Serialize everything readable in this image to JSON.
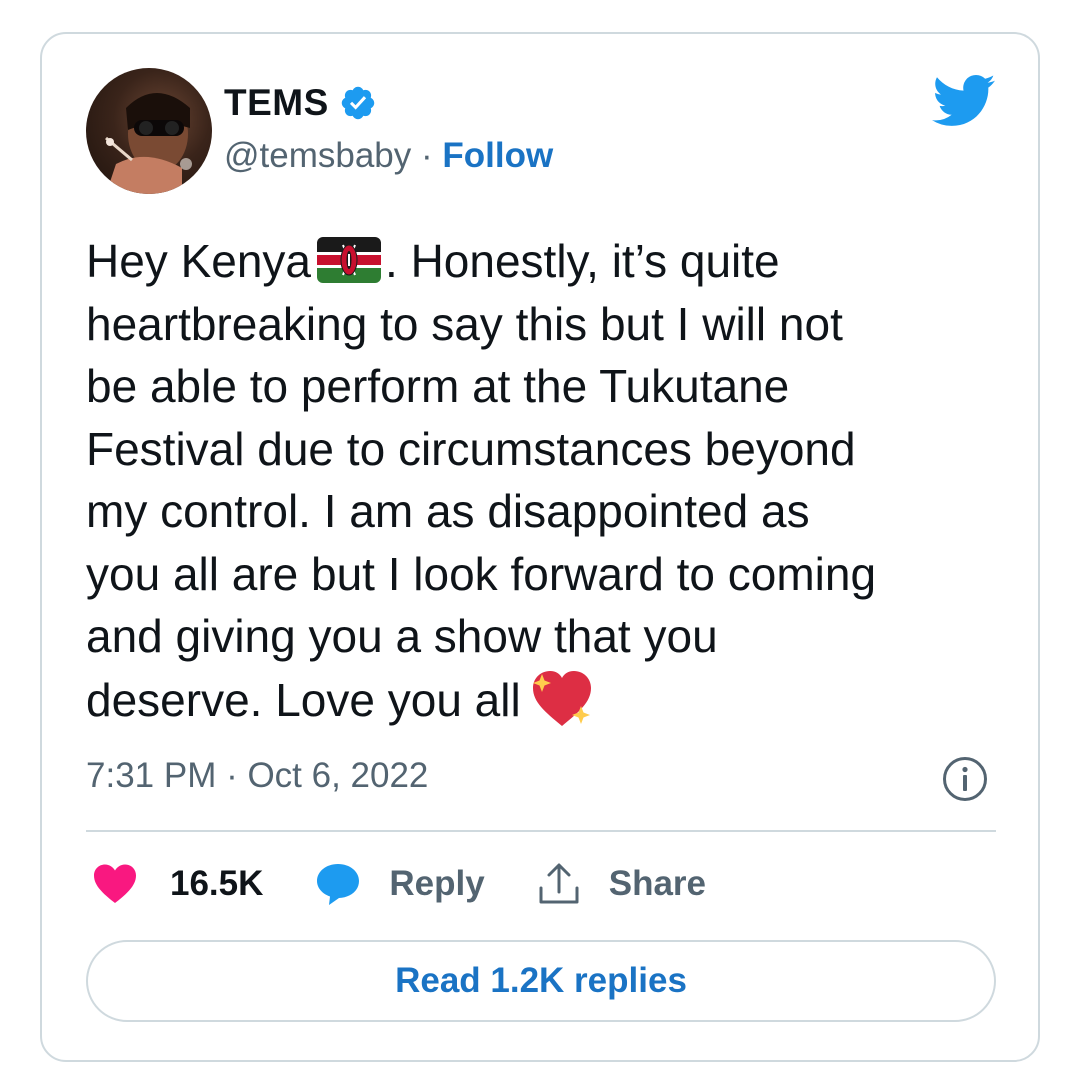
{
  "author": {
    "name": "TEMS",
    "handle": "@temsbaby",
    "separator": " · ",
    "follow_label": "Follow",
    "verified": true
  },
  "tweet": {
    "lines": [
      "Hey Kenya",
      ". Honestly, it’s quite",
      "heartbreaking to say this but I will not",
      "be able to perform at the Tukutane",
      "Festival due to circumstances beyond",
      "my control. I am as disappointed as",
      "you all are but I look forward to coming",
      "and giving you a show that you",
      "deserve. Love you all"
    ],
    "emoji": [
      "kenya-flag",
      "sparkling-heart"
    ],
    "timestamp": "7:31 PM · Oct 6, 2022"
  },
  "actions": {
    "likes": "16.5K",
    "reply_label": "Reply",
    "share_label": "Share",
    "read_replies_label": "Read 1.2K replies"
  },
  "colors": {
    "accent": "#1d9bf0",
    "link": "#1a73c4",
    "like": "#f91880",
    "text": "#0f1419",
    "muted": "#536471",
    "border": "#cfd9de"
  }
}
